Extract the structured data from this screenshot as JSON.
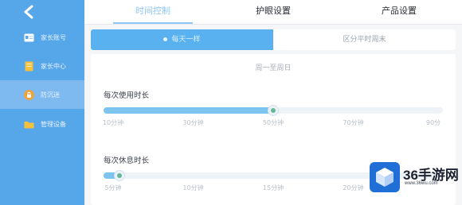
{
  "sidebar": {
    "items": [
      {
        "label": "家长账号",
        "icon": "id-card-icon",
        "color": "#ffffff"
      },
      {
        "label": "家长中心",
        "icon": "document-icon",
        "color": "#f3c13d"
      },
      {
        "label": "防沉迷",
        "icon": "lock-icon",
        "color": "#f0a23a",
        "active": true
      },
      {
        "label": "管理设备",
        "icon": "folder-icon",
        "color": "#f3c13d"
      }
    ]
  },
  "tabs": [
    {
      "label": "时间控制",
      "active": true
    },
    {
      "label": "护眼设置",
      "active": false
    },
    {
      "label": "产品设置",
      "active": false
    }
  ],
  "segments": [
    {
      "label": "每天一样",
      "active": true
    },
    {
      "label": "区分平时周末",
      "active": false
    }
  ],
  "card": {
    "subtitle": "周一至周日",
    "usage": {
      "label": "每次使用时长",
      "value_fraction": 0.5,
      "ticks": [
        "10分钟",
        "30分钟",
        "50分钟",
        "70分钟",
        "90分"
      ]
    },
    "rest": {
      "label": "每次休息时长",
      "value_fraction": 0.02,
      "ticks": [
        "5分钟",
        "10分钟",
        "15分钟",
        "20分钟"
      ]
    }
  },
  "watermark": {
    "text": "36手游网",
    "url": "www.36wu.com"
  },
  "colors": {
    "sidebar": "#56a6ea",
    "accent": "#59b2ef",
    "slider_fill": "#7ec4f0",
    "watermark_blue": "#1f6fd6"
  }
}
